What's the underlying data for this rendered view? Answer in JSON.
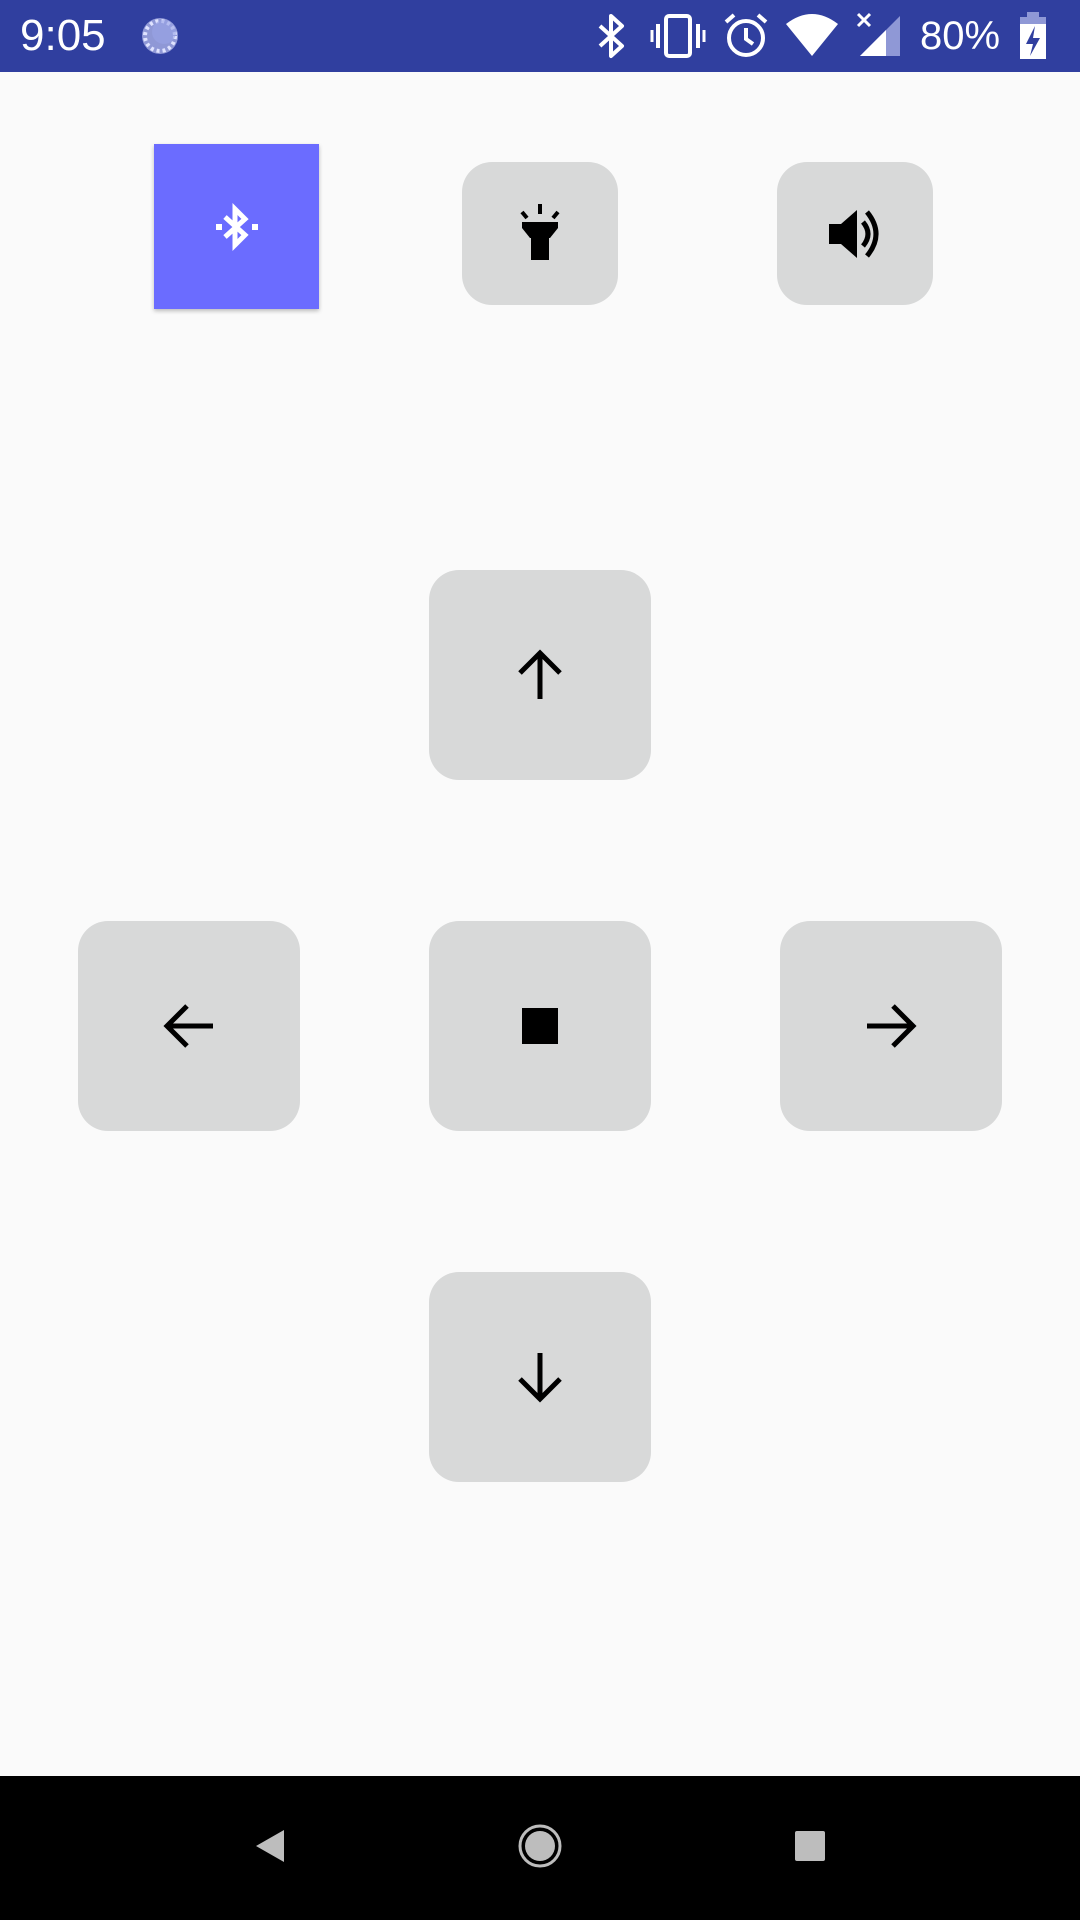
{
  "status_bar": {
    "time": "9:05",
    "battery_percent": "80%",
    "background_color": "#303f9f",
    "icons": [
      "loading-spinner-icon",
      "bluetooth-icon",
      "vibrate-icon",
      "alarm-icon",
      "wifi-icon",
      "cellular-no-service-icon",
      "battery-charging-icon"
    ]
  },
  "toolbar": {
    "buttons": [
      {
        "name": "bluetooth-button",
        "icon": "bluetooth-searching-icon",
        "active": true,
        "color": "#6b6cff"
      },
      {
        "name": "flashlight-button",
        "icon": "flashlight-icon",
        "active": false
      },
      {
        "name": "volume-button",
        "icon": "volume-up-icon",
        "active": false
      }
    ]
  },
  "dpad": {
    "button_color": "#d8d9d9",
    "buttons": [
      {
        "name": "up-button",
        "icon": "arrow-up-icon"
      },
      {
        "name": "left-button",
        "icon": "arrow-left-icon"
      },
      {
        "name": "stop-button",
        "icon": "stop-icon"
      },
      {
        "name": "right-button",
        "icon": "arrow-right-icon"
      },
      {
        "name": "down-button",
        "icon": "arrow-down-icon"
      }
    ]
  },
  "nav_bar": {
    "buttons": [
      "back-icon",
      "home-icon",
      "recents-icon"
    ]
  }
}
